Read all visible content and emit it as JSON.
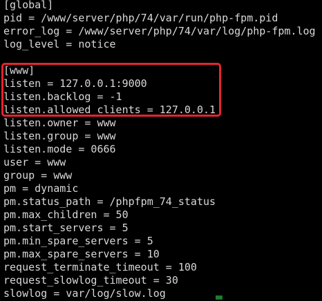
{
  "terminal": {
    "lines": [
      "[global]",
      "pid = /www/server/php/74/var/run/php-fpm.pid",
      "error_log = /www/server/php/74/var/log/php-fpm.log",
      "log_level = notice",
      "",
      "[www]",
      "listen = 127.0.0.1:9000",
      "listen.backlog = -1",
      "listen.allowed_clients = 127.0.0.1",
      "listen.owner = www",
      "listen.group = www",
      "listen.mode = 0666",
      "user = www",
      "group = www",
      "pm = dynamic",
      "pm.status_path = /phpfpm_74_status",
      "pm.max_children = 50",
      "pm.start_servers = 5",
      "pm.min_spare_servers = 5",
      "pm.max_spare_servers = 10",
      "request_terminate_timeout = 100",
      "request_slowlog_timeout = 30",
      "slowlog = var/log/slow.log"
    ]
  },
  "colors": {
    "background": "#000000",
    "text": "#d9d9d9",
    "highlight_border": "#e8242b",
    "cursor": "#1f7a2e"
  }
}
